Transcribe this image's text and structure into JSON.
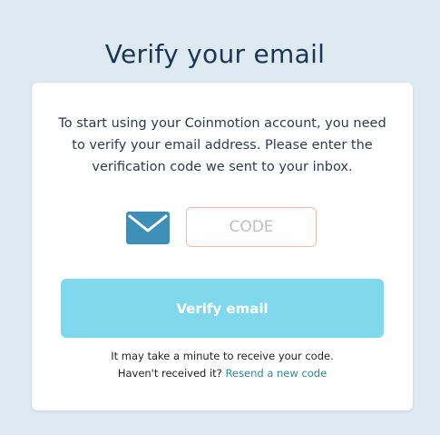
{
  "page": {
    "title": "Verify your email"
  },
  "card": {
    "intro_text": "To start using your Coinmotion account, you need to verify your email address. Please enter the verification code we sent to your inbox.",
    "code_input": {
      "placeholder": "CODE",
      "value": ""
    },
    "verify_button_label": "Verify email",
    "hint_line_1": "It may take a minute to receive your code.",
    "hint_line_2_prefix": "Haven't received it?",
    "resend_link_label": "Resend a new code"
  },
  "icons": {
    "envelope": "envelope-icon"
  },
  "colors": {
    "background": "#deeaf2",
    "title": "#1b3553",
    "envelope": "#3e8fb7",
    "code_border": "#f0b8a4",
    "button": "#7fd8ec",
    "link": "#2a8aa0"
  }
}
